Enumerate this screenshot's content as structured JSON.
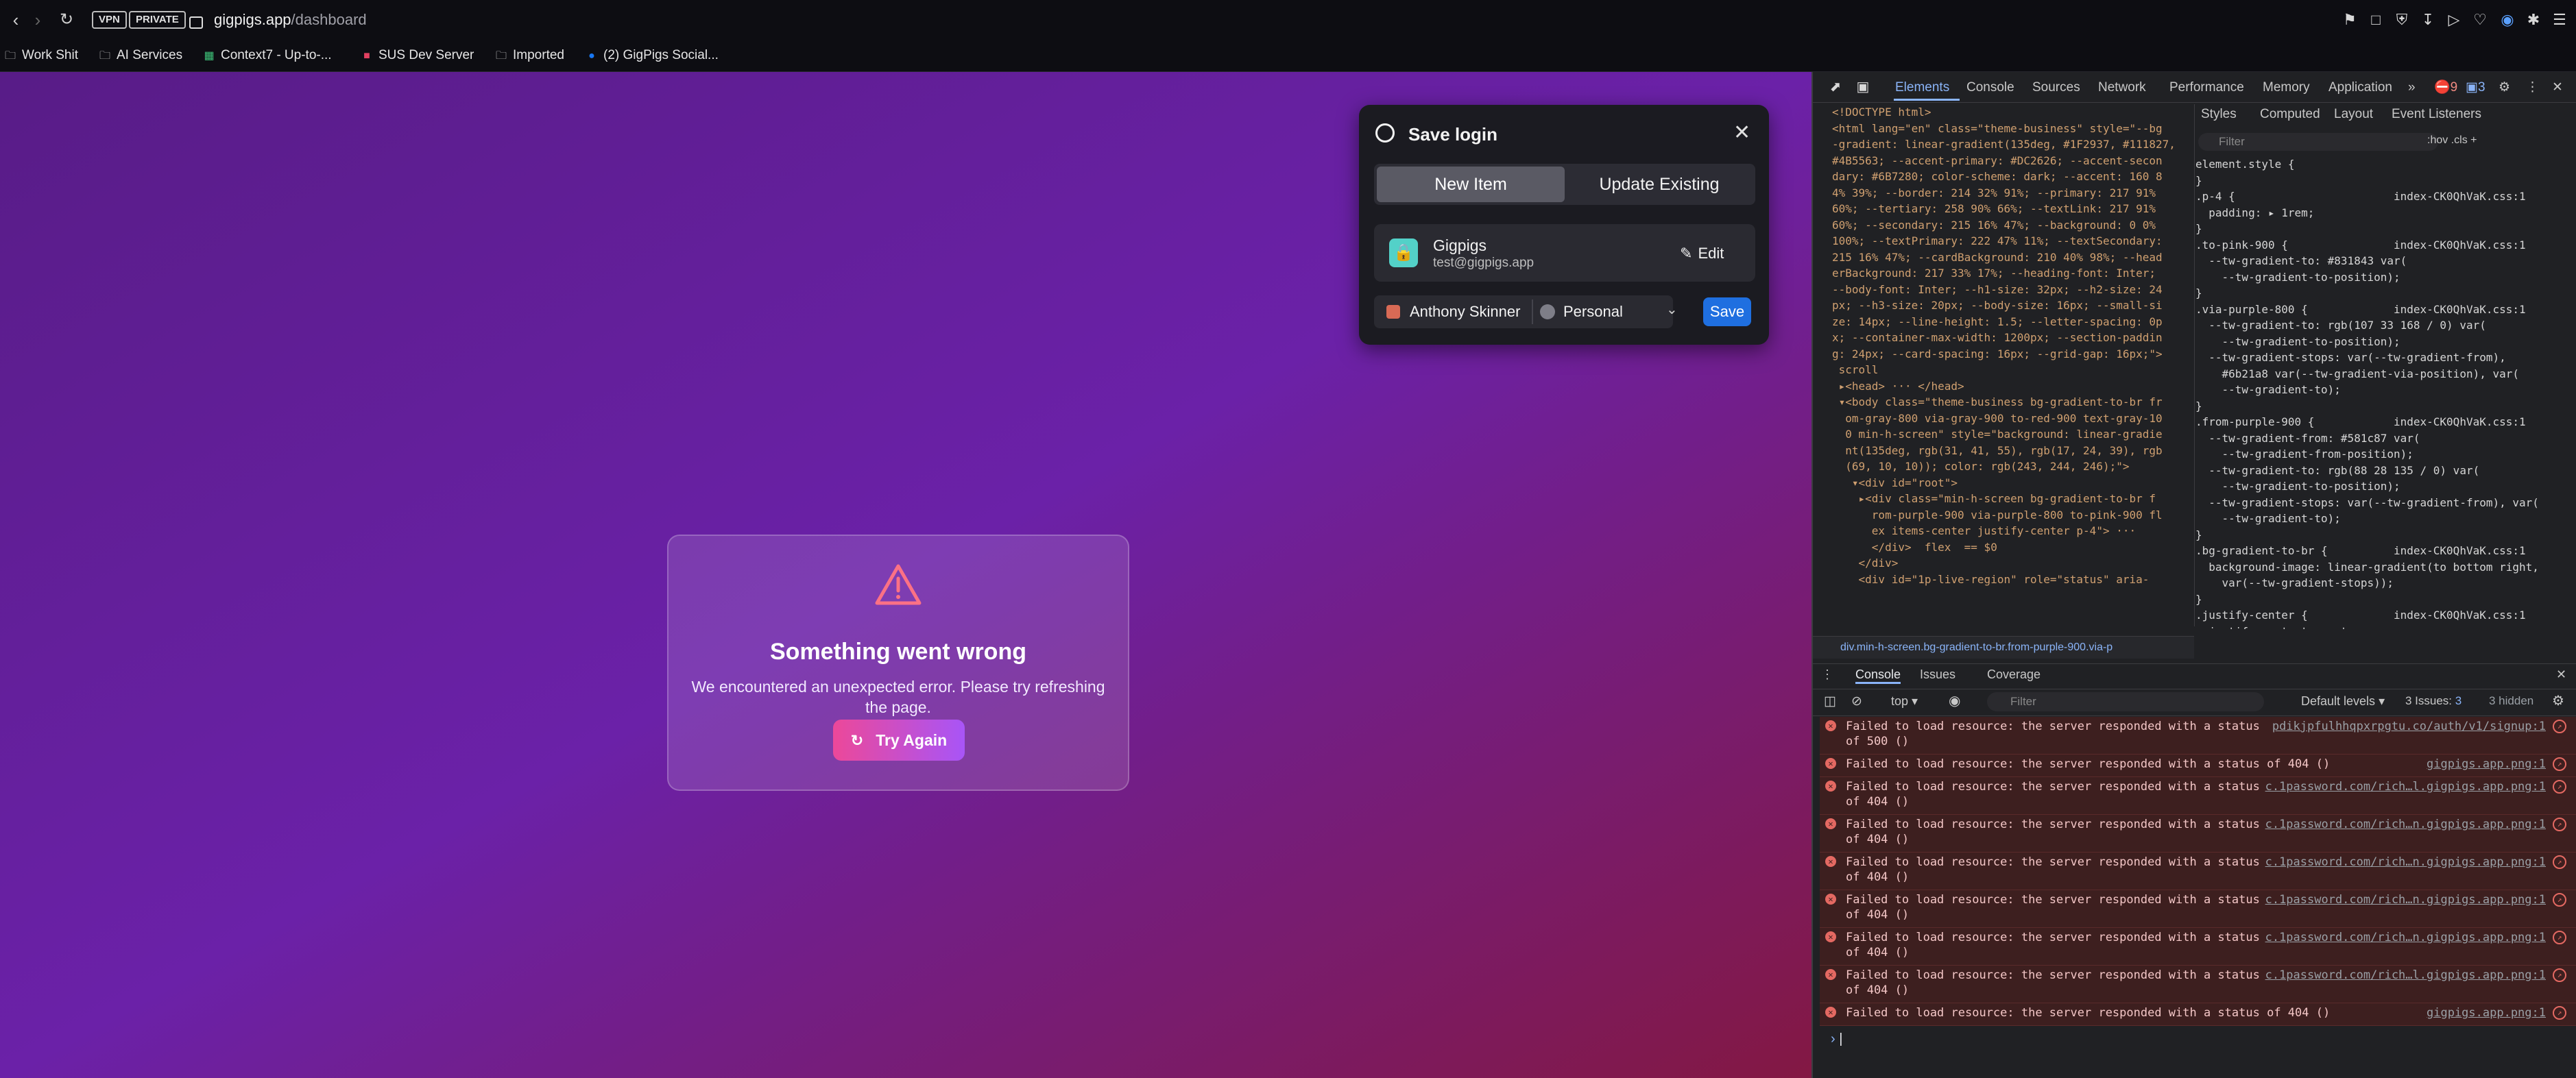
{
  "browser": {
    "badges": [
      "VPN",
      "PRIVATE"
    ],
    "url_host": "gigpigs.app",
    "url_path": "/dashboard",
    "bookmarks": [
      {
        "label": "Work Shit",
        "icon": "folder-icon"
      },
      {
        "label": "AI Services",
        "icon": "folder-icon"
      },
      {
        "label": "Context7 - Up-to-...",
        "icon": "context7-favicon"
      },
      {
        "label": "SUS Dev Server",
        "icon": "sus-favicon"
      },
      {
        "label": "Imported",
        "icon": "folder-icon"
      },
      {
        "label": "(2) GigPigs Social...",
        "icon": "facebook-favicon"
      }
    ]
  },
  "page": {
    "error_title": "Something went wrong",
    "error_message": "We encountered an unexpected error. Please try refreshing the page.",
    "retry_label": "Try Again"
  },
  "save_login": {
    "title": "Save login",
    "tab_new": "New Item",
    "tab_update": "Update Existing",
    "item_name": "Gigpigs",
    "item_email": "test@gigpigs.app",
    "edit_label": "Edit",
    "account": "Anthony Skinner",
    "vault": "Personal",
    "save_label": "Save"
  },
  "devtools": {
    "tabs": [
      "Elements",
      "Console",
      "Sources",
      "Network",
      "Performance",
      "Memory",
      "Application"
    ],
    "error_count": "9",
    "issue_count": "3",
    "elements_code": "<!DOCTYPE html>\n<html lang=\"en\" class=\"theme-business\" style=\"--bg\n-gradient: linear-gradient(135deg, #1F2937, #111827, #450A0A); --card-bg: #374151; --card-hover-bg:\n#4B5563; --accent-primary: #DC2626; --accent-secon\ndary: #6B7280; color-scheme: dark; --accent: 160 8\n4% 39%; --border: 214 32% 91%; --primary: 217 91%\n60%; --tertiary: 258 90% 66%; --textLink: 217 91%\n60%; --secondary: 215 16% 47%; --background: 0 0%\n100%; --textPrimary: 222 47% 11%; --textSecondary:\n215 16% 47%; --cardBackground: 210 40% 98%; --head\nerBackground: 217 33% 17%; --heading-font: Inter;\n--body-font: Inter; --h1-size: 32px; --h2-size: 24\npx; --h3-size: 20px; --body-size: 16px; --small-si\nze: 14px; --line-height: 1.5; --letter-spacing: 0p\nx; --container-max-width: 1200px; --section-paddin\ng: 24px; --card-spacing: 16px; --grid-gap: 16px;\">\n scroll\n ▸<head> ··· </head>\n ▾<body class=\"theme-business bg-gradient-to-br fr\n  om-gray-800 via-gray-900 to-red-900 text-gray-10\n  0 min-h-screen\" style=\"background: linear-gradie\n  nt(135deg, rgb(31, 41, 55), rgb(17, 24, 39), rgb\n  (69, 10, 10)); color: rgb(243, 244, 246);\">\n   ▾<div id=\"root\">\n    ▸<div class=\"min-h-screen bg-gradient-to-br f\n      rom-purple-900 via-purple-800 to-pink-900 fl\n      ex items-center justify-center p-4\"> ···\n      </div>  flex  == $0\n    </div>\n    <div id=\"1p-live-region\" role=\"status\" aria-",
    "breadcrumb": "div.min-h-screen.bg-gradient-to-br.from-purple-900.via-p",
    "styles_tabs": [
      "Styles",
      "Computed",
      "Layout",
      "Event Listeners"
    ],
    "styles_filter": "Filter",
    "styles_code": "element.style {\n}\n.p-4 {                        index-CK0QhVaK.css:1\n  padding: ▸ 1rem;\n}\n.to-pink-900 {                index-CK0QhVaK.css:1\n  --tw-gradient-to: #831843 var(\n    --tw-gradient-to-position);\n}\n.via-purple-800 {             index-CK0QhVaK.css:1\n  --tw-gradient-to: rgb(107 33 168 / 0) var(\n    --tw-gradient-to-position);\n  --tw-gradient-stops: var(--tw-gradient-from),\n    #6b21a8 var(--tw-gradient-via-position), var(\n    --tw-gradient-to);\n}\n.from-purple-900 {            index-CK0QhVaK.css:1\n  --tw-gradient-from: #581c87 var(\n    --tw-gradient-from-position);\n  --tw-gradient-to: rgb(88 28 135 / 0) var(\n    --tw-gradient-to-position);\n  --tw-gradient-stops: var(--tw-gradient-from), var(\n    --tw-gradient-to);\n}\n.bg-gradient-to-br {          index-CK0QhVaK.css:1\n  background-image: linear-gradient(to bottom right,\n    var(--tw-gradient-stops));\n}\n.justify-center {             index-CK0QhVaK.css:1\n  justify-content: center;",
    "drawer_tabs": [
      "Console",
      "Issues",
      "Coverage"
    ],
    "context": "top",
    "filter_placeholder": "Filter",
    "levels": "Default levels",
    "issues_summary": "3 Issues:",
    "issues_count": "3",
    "hidden": "3 hidden",
    "logs": [
      {
        "msg": "Failed to load resource: the server responded with a status\nof 500 ()",
        "src": "pdikjpfulhhqpxrpgtu.co/auth/v1/signup:1"
      },
      {
        "msg": "Failed to load resource: the server responded with a status of 404 ()",
        "src": "gigpigs.app.png:1"
      },
      {
        "msg": "Failed to load resource: the server responded with a status\nof 404 ()",
        "src": "c.1password.com/rich…l.gigpigs.app.png:1"
      },
      {
        "msg": "Failed to load resource: the server responded with a status\nof 404 ()",
        "src": "c.1password.com/rich…n.gigpigs.app.png:1"
      },
      {
        "msg": "Failed to load resource: the server responded with a status\nof 404 ()",
        "src": "c.1password.com/rich…n.gigpigs.app.png:1"
      },
      {
        "msg": "Failed to load resource: the server responded with a status\nof 404 ()",
        "src": "c.1password.com/rich…n.gigpigs.app.png:1"
      },
      {
        "msg": "Failed to load resource: the server responded with a status\nof 404 ()",
        "src": "c.1password.com/rich…n.gigpigs.app.png:1"
      },
      {
        "msg": "Failed to load resource: the server responded with a status\nof 404 ()",
        "src": "c.1password.com/rich…l.gigpigs.app.png:1"
      },
      {
        "msg": "Failed to load resource: the server responded with a status of 404 ()",
        "src": "gigpigs.app.png:1"
      }
    ]
  }
}
